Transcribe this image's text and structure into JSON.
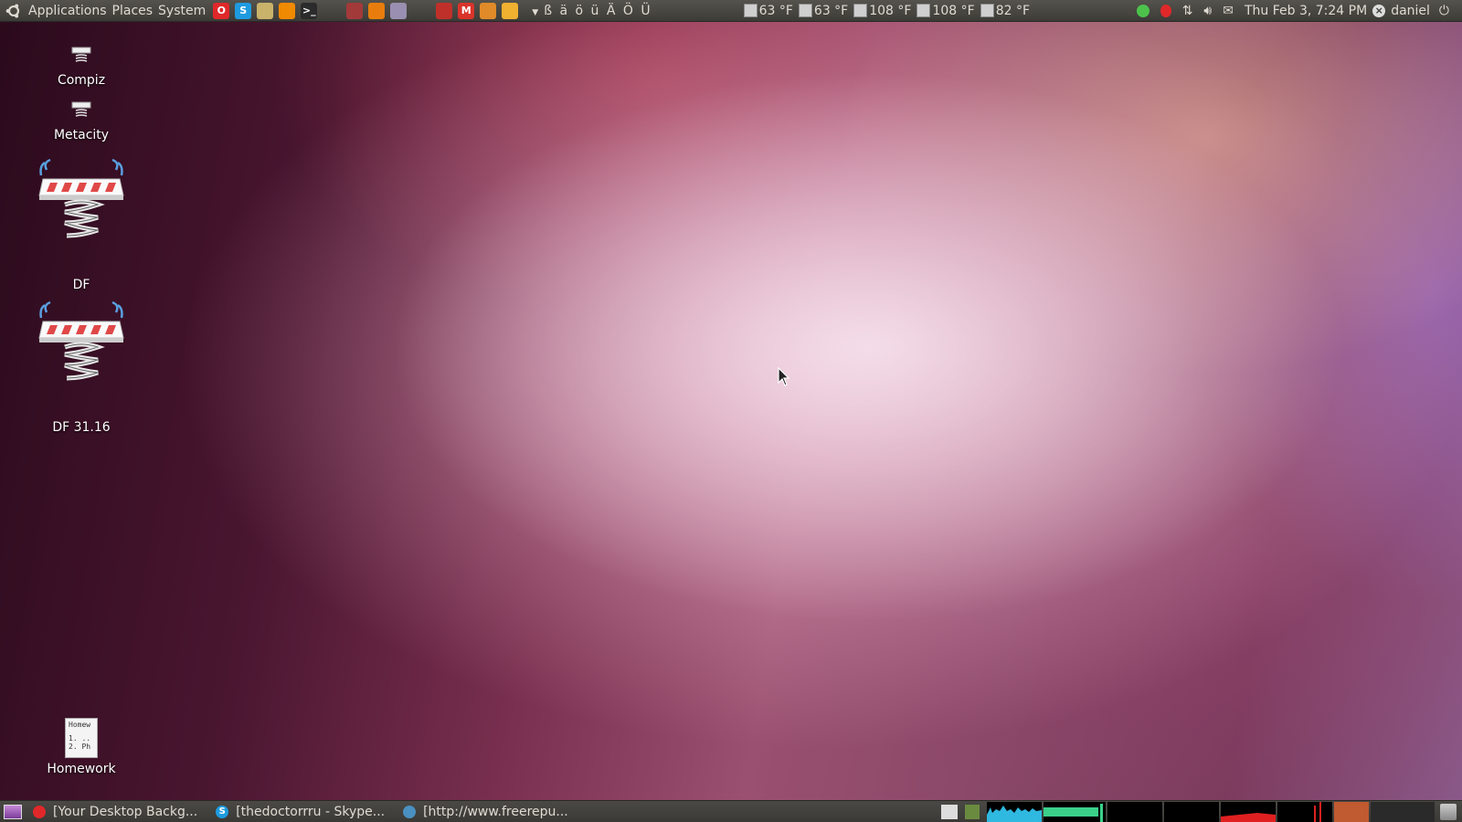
{
  "top_panel": {
    "menus": [
      "Applications",
      "Places",
      "System"
    ],
    "launchers": [
      {
        "name": "opera",
        "color": "#e0282a",
        "glyph": "O"
      },
      {
        "name": "skype",
        "color": "#1e9be0",
        "glyph": "S"
      },
      {
        "name": "banshee",
        "color": "#c9b26a",
        "glyph": ""
      },
      {
        "name": "vlc",
        "color": "#f08a00",
        "glyph": ""
      },
      {
        "name": "terminal",
        "color": "#2b2b2b",
        "glyph": ">_"
      },
      {
        "name": "tool",
        "color": "#a33a3a",
        "glyph": ""
      },
      {
        "name": "blender",
        "color": "#e87d0d",
        "glyph": ""
      },
      {
        "name": "inkscape",
        "color": "#9a8fb0",
        "glyph": ""
      },
      {
        "name": "mahjong",
        "color": "#c0302a",
        "glyph": ""
      },
      {
        "name": "gmail",
        "color": "#d9342b",
        "glyph": "M"
      },
      {
        "name": "files",
        "color": "#e08a2a",
        "glyph": ""
      },
      {
        "name": "app",
        "color": "#f0b030",
        "glyph": ""
      }
    ],
    "special_chars": "ß ä ö ü Ä Ö Ü",
    "temperatures": [
      "63 °F",
      "63 °F",
      "108 °F",
      "108 °F",
      "82 °F"
    ],
    "clock": "Thu Feb  3, 7:24 PM",
    "user": "daniel"
  },
  "desktop_icons": [
    {
      "label": "Compiz"
    },
    {
      "label": "Metacity"
    },
    {
      "label": "DF"
    },
    {
      "label": "DF 31.16"
    },
    {
      "label": "Homework"
    }
  ],
  "homework_preview": [
    "Homew",
    "1. ..",
    "2. Ph"
  ],
  "taskbar": [
    {
      "label": "[Your Desktop Backg...",
      "color": "#e0282a",
      "glyph": ""
    },
    {
      "label": "[thedoctorrru - Skype...",
      "color": "#1e9be0",
      "glyph": "S"
    },
    {
      "label": "[http://www.freerepu...",
      "color": "#4a90c0",
      "glyph": ""
    }
  ],
  "colors": {
    "panel_bg": "#3c3b37",
    "panel_text": "#dfdbd2",
    "cpu_graph": "#2fb8e0",
    "mem_graph": "#3ad08a",
    "net_graph": "#e02020",
    "load_graph": "#c05a30"
  }
}
